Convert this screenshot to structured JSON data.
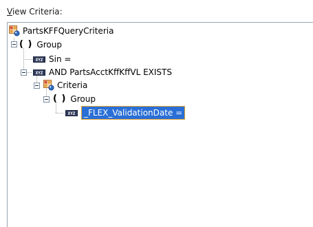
{
  "view_criteria_label": {
    "mnemonic": "V",
    "rest": "iew Criteria:"
  },
  "tree": {
    "root": {
      "label": "PartsKFFQueryCriteria",
      "icon": "criteria-icon"
    },
    "group1": {
      "label": "Group",
      "paren": "( )"
    },
    "attr_sin": {
      "label": "Sin =",
      "icon": "xyz-attribute-icon"
    },
    "exists": {
      "label": "AND PartsAcctKffKffVL EXISTS",
      "icon": "xyz-attribute-icon"
    },
    "criteria": {
      "label": "Criteria",
      "icon": "criteria-icon"
    },
    "group2": {
      "label": "Group",
      "paren": "( )"
    },
    "flex": {
      "label": "_FLEX_ValidationDate =",
      "icon": "xyz-attribute-icon",
      "selected": true
    }
  },
  "icon_text": "XYZ",
  "colors": {
    "selection": "#2a6fd6",
    "selection_border": "#e8a42c"
  }
}
